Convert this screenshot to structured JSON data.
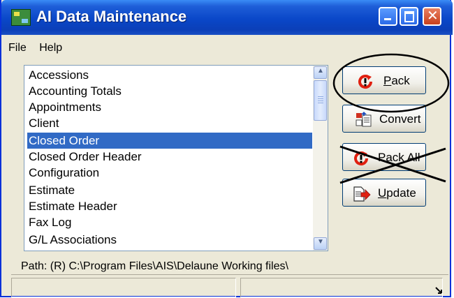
{
  "window": {
    "title": "AI Data Maintenance",
    "controls": [
      "minimize",
      "maximize",
      "close"
    ]
  },
  "menu": {
    "items": [
      "File",
      "Help"
    ]
  },
  "list": {
    "items": [
      "Accessions",
      "Accounting Totals",
      "Appointments",
      "Client",
      "Closed Order",
      "Closed Order Header",
      "Configuration",
      "Estimate",
      "Estimate Header",
      "Fax Log",
      "G/L Associations"
    ],
    "selected_index": 4,
    "selected_label": "Closed Order"
  },
  "buttons": {
    "pack": {
      "label_accel": "P",
      "label_rest": "ack",
      "icon": "refresh-alert-icon"
    },
    "convert": {
      "label": "Convert",
      "icon": "convert-icon"
    },
    "pack_all": {
      "label": "Pack All",
      "icon": "refresh-alert-icon"
    },
    "update": {
      "label_accel": "U",
      "label_rest": "pdate",
      "icon": "update-arrow-icon"
    }
  },
  "status": {
    "path": "Path: (R) C:\\Program Files\\AIS\\Delaune Working files\\"
  },
  "annotations": {
    "circled": "Pack",
    "crossed_out": "Pack All"
  },
  "colors": {
    "titlebar": "#0a47c8",
    "selection": "#316ac5",
    "window_bg": "#ece9d8",
    "icon_red": "#e02010"
  }
}
